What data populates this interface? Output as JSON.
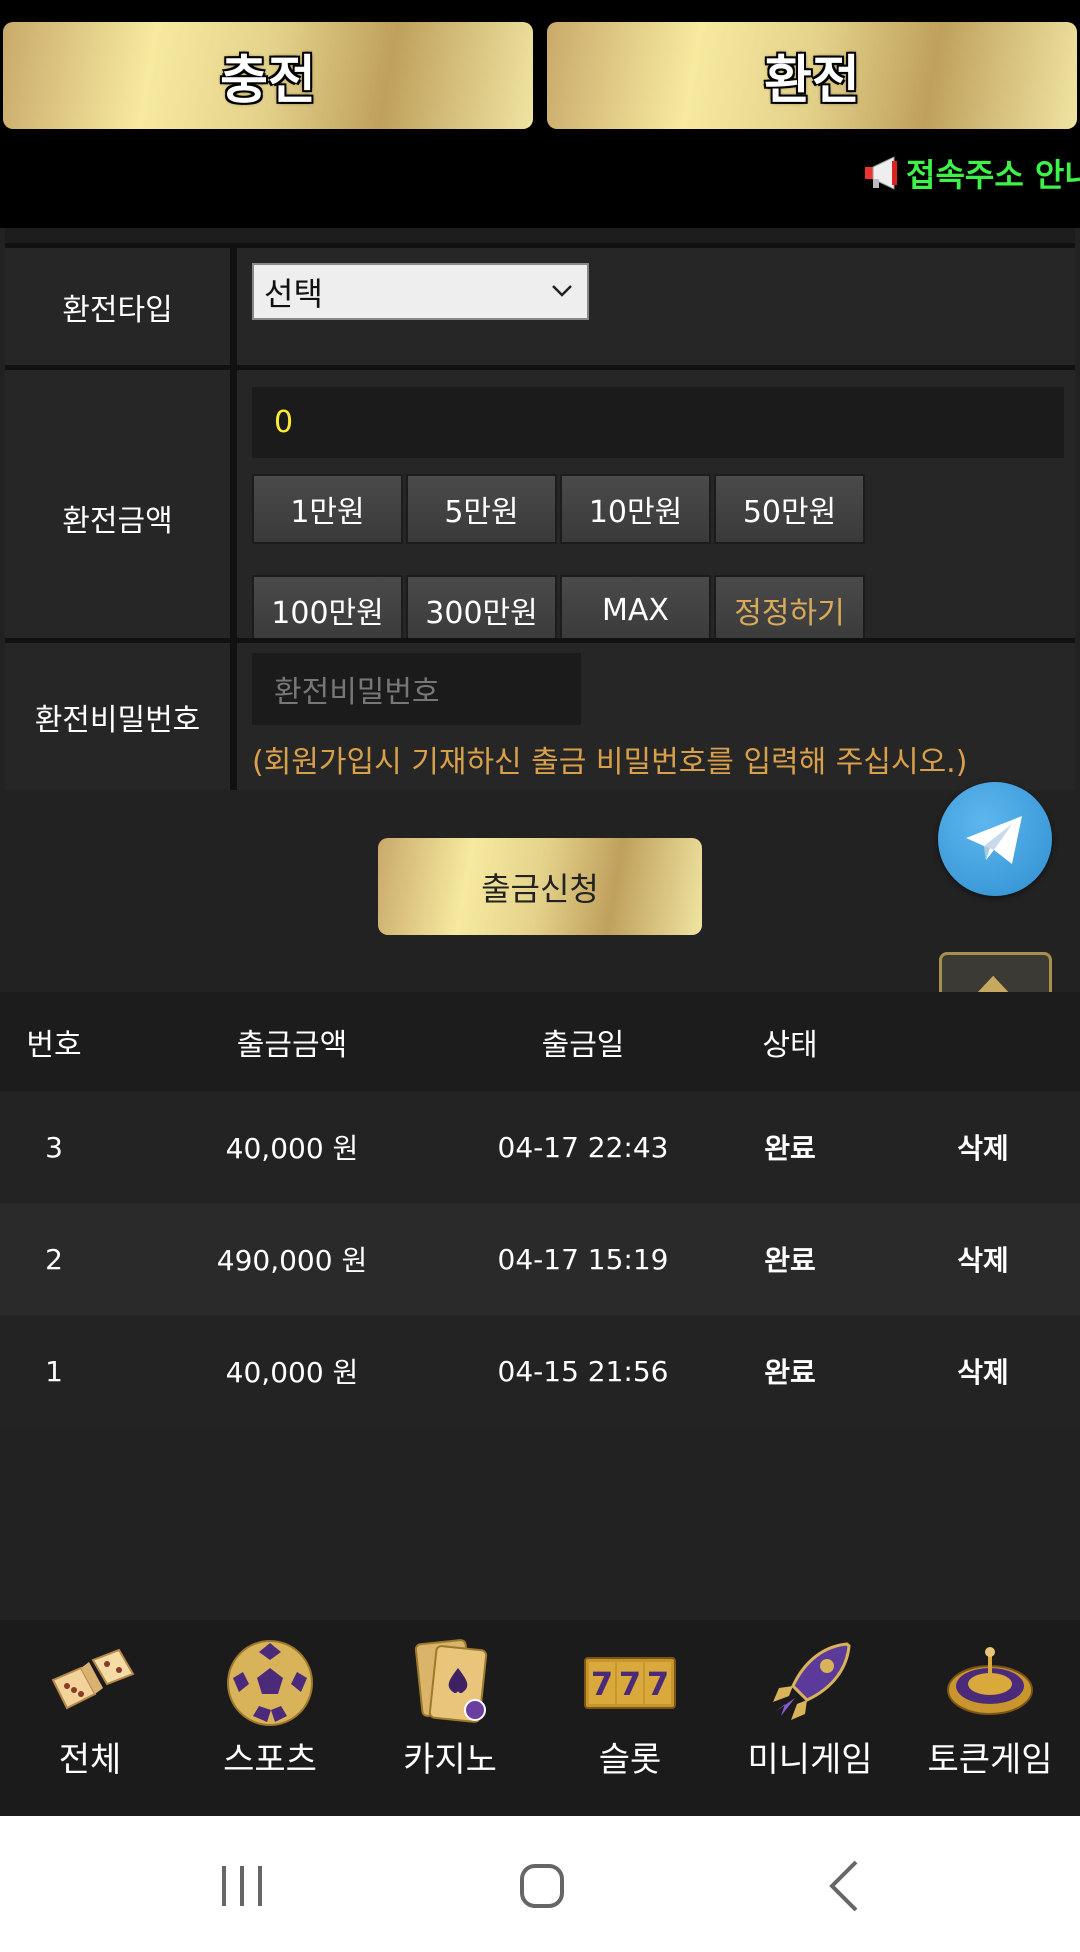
{
  "top_buttons": {
    "charge": "충전",
    "exchange": "환전"
  },
  "notice": {
    "text": "접속주소 안내"
  },
  "form": {
    "type_label": "환전타입",
    "type_select_value": "선택",
    "amount_label": "환전금액",
    "amount_value": "0",
    "amount_buttons": [
      "1만원",
      "5만원",
      "10만원",
      "50만원",
      "100만원",
      "300만원",
      "MAX",
      "정정하기"
    ],
    "password_label": "환전비밀번호",
    "password_placeholder": "환전비밀번호",
    "password_note": "(회원가입시 기재하신 출금 비밀번호를 입력해 주십시오.)",
    "submit_label": "출금신청"
  },
  "table": {
    "headers": [
      "번호",
      "출금금액",
      "출금일",
      "상태"
    ],
    "rows": [
      {
        "no": "3",
        "amount": "40,000 원",
        "date": "04-17 22:43",
        "status": "완료",
        "action": "삭제"
      },
      {
        "no": "2",
        "amount": "490,000 원",
        "date": "04-17 15:19",
        "status": "완료",
        "action": "삭제"
      },
      {
        "no": "1",
        "amount": "40,000 원",
        "date": "04-15 21:56",
        "status": "완료",
        "action": "삭제"
      }
    ]
  },
  "bottom_nav": [
    {
      "label": "전체",
      "icon": "dice-icon"
    },
    {
      "label": "스포츠",
      "icon": "soccer-ball-icon"
    },
    {
      "label": "카지노",
      "icon": "playing-cards-icon"
    },
    {
      "label": "슬롯",
      "icon": "slot-777-icon"
    },
    {
      "label": "미니게임",
      "icon": "rocket-icon"
    },
    {
      "label": "토큰게임",
      "icon": "roulette-icon"
    }
  ],
  "colors": {
    "notice_green": "#3ff24a",
    "accent_gold": "#d9aa5a",
    "amount_yellow": "#ffea3a",
    "telegram_blue": "#2f8fd0"
  }
}
